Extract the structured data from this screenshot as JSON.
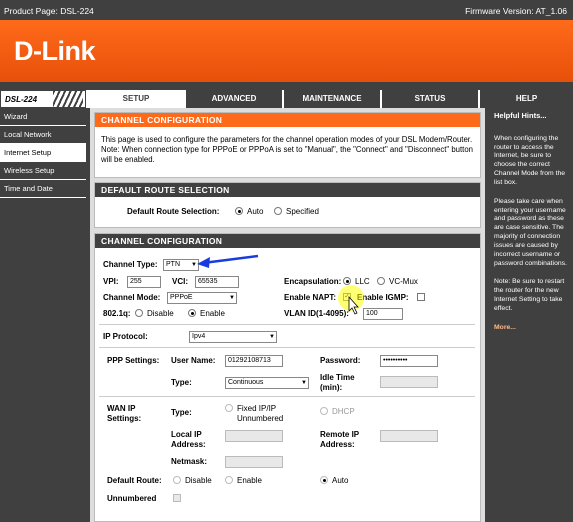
{
  "header": {
    "product_page": "Product Page: DSL-224",
    "firmware": "Firmware Version: AT_1.06",
    "logo": "D-Link",
    "model": "DSL-224"
  },
  "tabs": [
    {
      "label": "SETUP",
      "active": true
    },
    {
      "label": "ADVANCED",
      "active": false
    },
    {
      "label": "MAINTENANCE",
      "active": false
    },
    {
      "label": "STATUS",
      "active": false
    },
    {
      "label": "HELP",
      "active": false
    }
  ],
  "sidebar": {
    "items": [
      {
        "label": "Wizard",
        "active": false
      },
      {
        "label": "Local Network",
        "active": false
      },
      {
        "label": "Internet Setup",
        "active": true
      },
      {
        "label": "Wireless Setup",
        "active": false
      },
      {
        "label": "Time and Date",
        "active": false
      }
    ]
  },
  "intro": {
    "title": "CHANNEL CONFIGURATION",
    "text": "This page is used to configure the parameters for the channel operation modes of your DSL Modem/Router. Note: When connection type for PPPoE or PPPoA is set to \"Manual\", the \"Connect\" and \"Disconnect\" button will be enabled."
  },
  "default_route": {
    "title": "DEFAULT ROUTE SELECTION",
    "label": "Default Route Selection:",
    "auto": "Auto",
    "specified": "Specified",
    "selected": "Auto"
  },
  "channel": {
    "title": "CHANNEL CONFIGURATION",
    "channel_type_label": "Channel Type:",
    "channel_type_value": "PTN",
    "vpi_label": "VPI:",
    "vpi_value": "255",
    "vci_label": "VCI:",
    "vci_value": "65535",
    "encapsulation_label": "Encapsulation:",
    "encap_llc": "LLC",
    "encap_vcmux": "VC-Mux",
    "encap_selected": "LLC",
    "channel_mode_label": "Channel Mode:",
    "channel_mode_value": "PPPoE",
    "enable_napt_label": "Enable NAPT:",
    "enable_napt": true,
    "enable_igmp_label": "Enable IGMP:",
    "enable_igmp": false,
    "dot1q_label": "802.1q:",
    "dot1q_disable": "Disable",
    "dot1q_enable": "Enable",
    "dot1q_selected": "Enable",
    "vlan_label": "VLAN ID(1-4095):",
    "vlan_value": "100",
    "ip_protocol_label": "IP Protocol:",
    "ip_protocol_value": "Ipv4",
    "ppp_settings_label": "PPP Settings:",
    "username_label": "User Name:",
    "username_value": "01292108713",
    "password_label": "Password:",
    "password_value": "••••••••••",
    "type_label": "Type:",
    "type_value": "Continuous",
    "idle_time_label": "Idle Time (min):",
    "idle_time_value": "",
    "wan_ip_label": "WAN IP Settings:",
    "wan_type_label": "Type:",
    "fixed_ip": "Fixed IP/IP Unnumbered",
    "dhcp": "DHCP",
    "local_ip_label": "Local IP Address:",
    "remote_ip_label": "Remote IP Address:",
    "netmask_label": "Netmask:",
    "default_route_label": "Default Route:",
    "dr_disable": "Disable",
    "dr_enable": "Enable",
    "dr_auto": "Auto",
    "dr_selected": "Auto",
    "unnumbered_label": "Unnumbered"
  },
  "hints": {
    "title": "Helpful Hints...",
    "p1": "When configuring the router to access the Internet, be sure to choose the correct Channel Mode from the list box.",
    "p2": "Please take care when entering your username and password as these are case sensitive. The majority of connection issues are caused by incorrect username or password combinations.",
    "p3": "Note: Be sure to restart the router for the new Internet Setting to take effect.",
    "more": "More..."
  },
  "colors": {
    "brand_orange": "#ff6a1a",
    "dark_gray": "#404040",
    "annotation_arrow": "#1a3be0",
    "cursor_highlight": "#ffff00"
  }
}
